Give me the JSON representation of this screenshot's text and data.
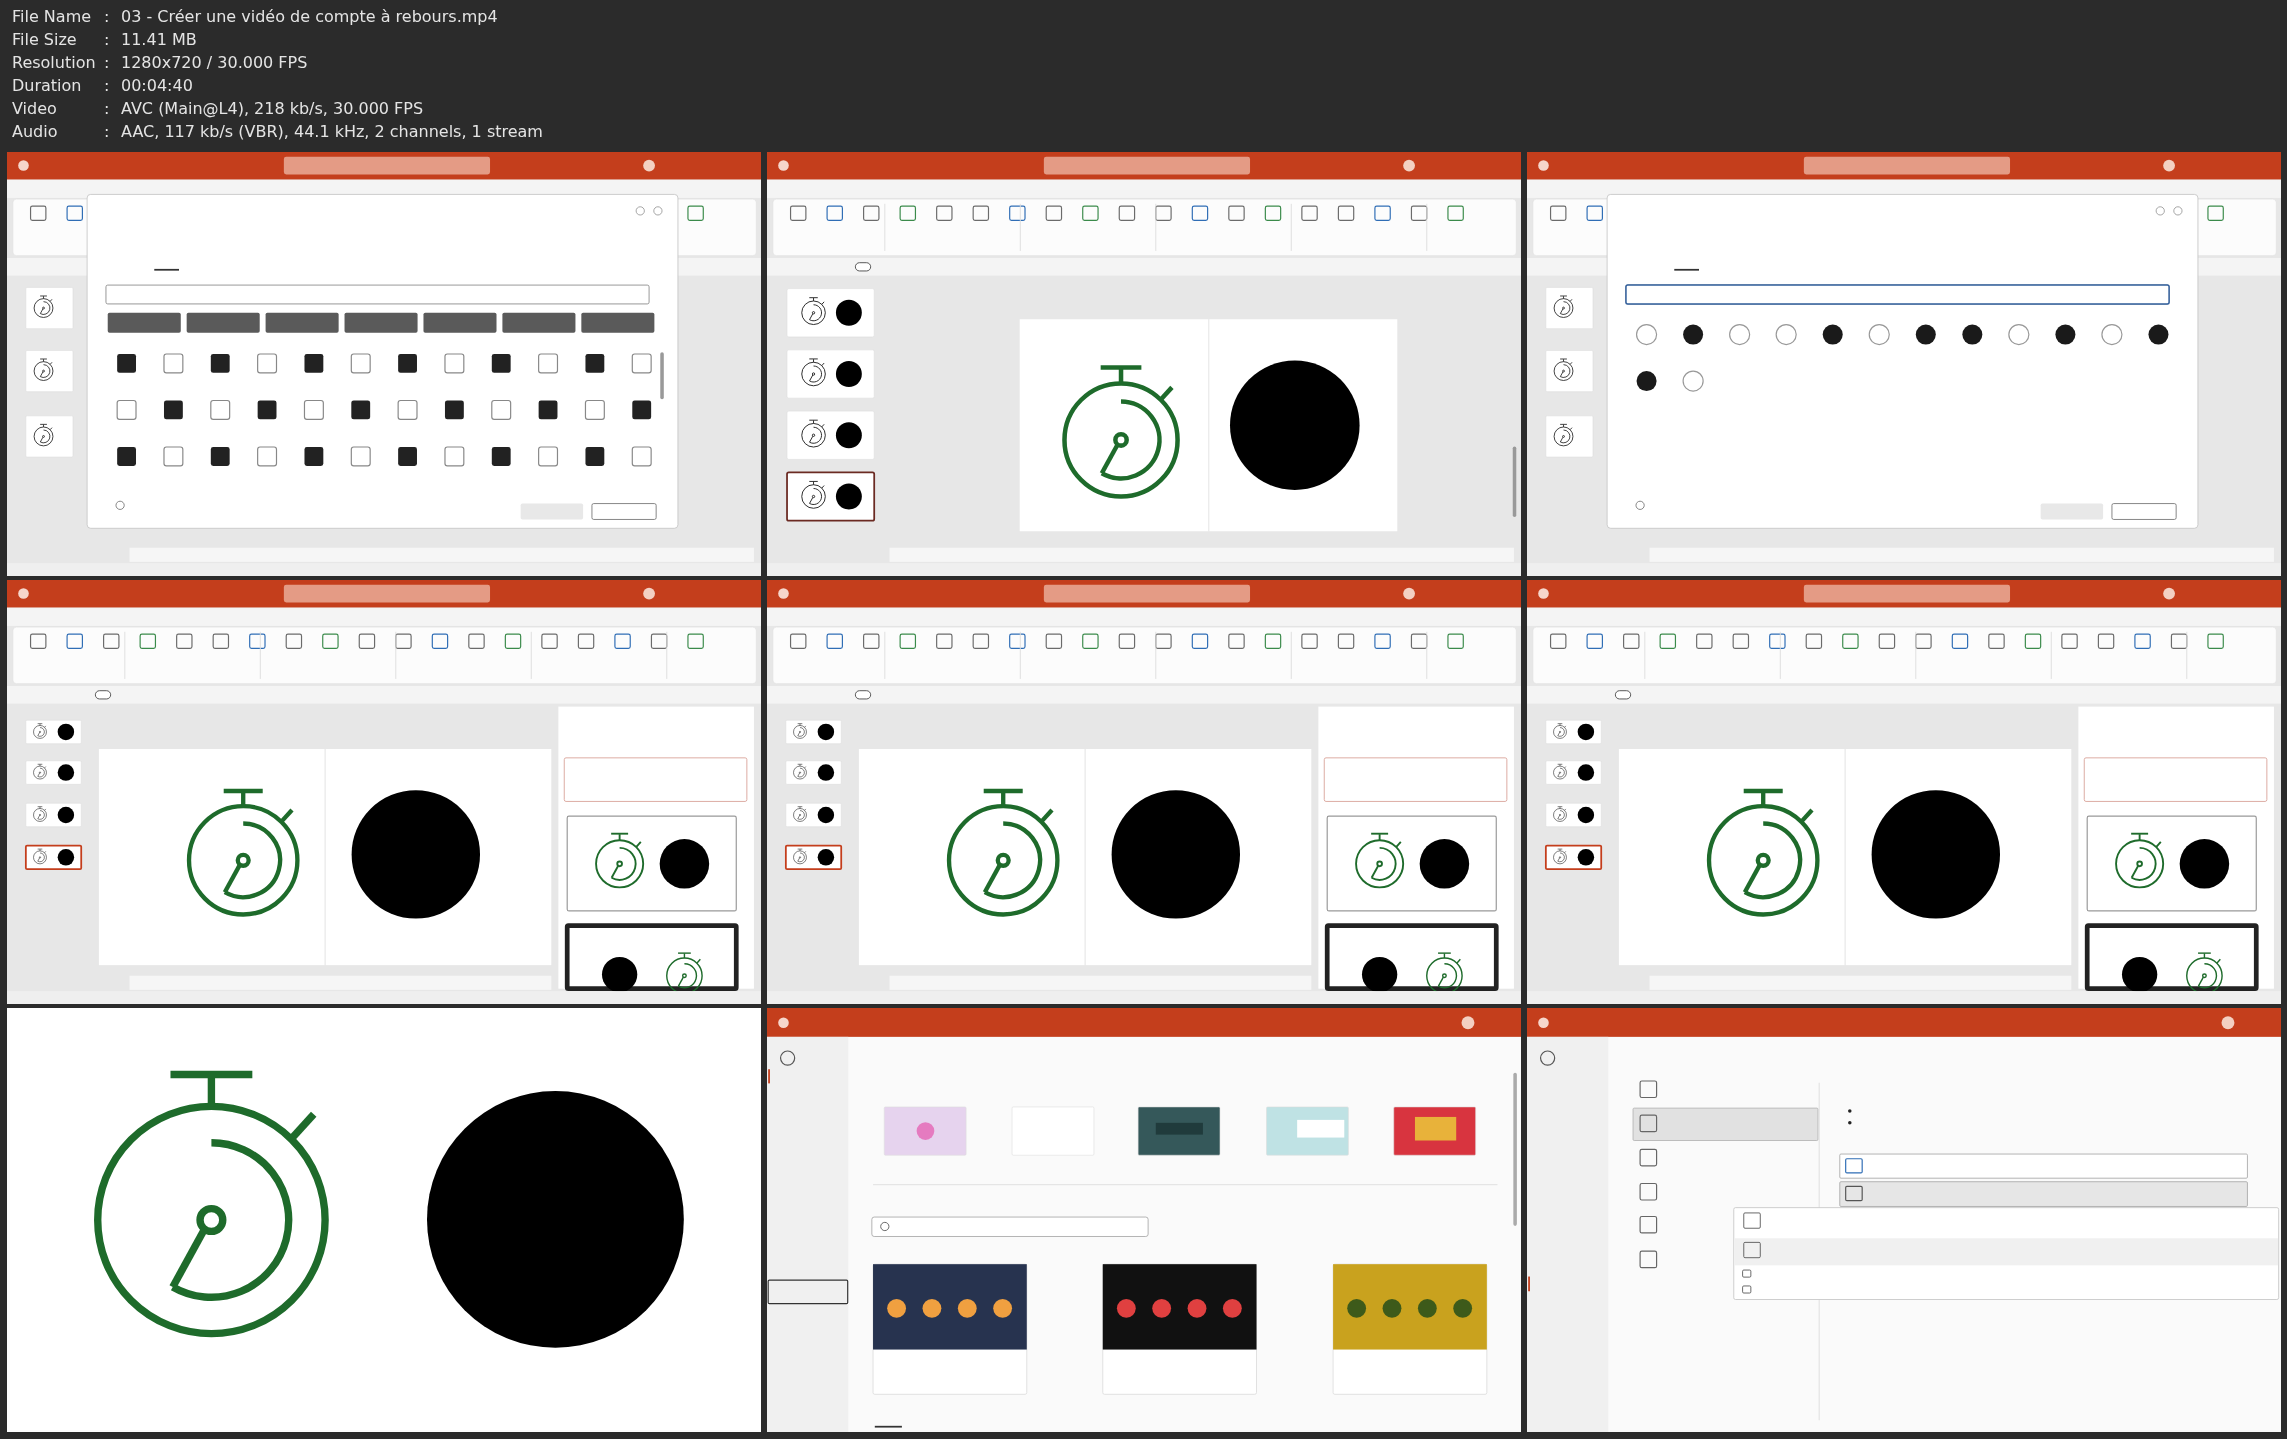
{
  "file_info": [
    {
      "label": "File Name",
      "separator": ":",
      "value": "03 - Créer une vidéo de compte à rebours.mp4"
    },
    {
      "label": "File Size",
      "separator": ":",
      "value": "11.41 MB"
    },
    {
      "label": "Resolution",
      "separator": ":",
      "value": "1280x720 / 30.000 FPS"
    },
    {
      "label": "Duration",
      "separator": ":",
      "value": "00:04:40"
    },
    {
      "label": "Video",
      "separator": ":",
      "value": "AVC (Main@L4), 218 kb/s, 30.000 FPS"
    },
    {
      "label": "Audio",
      "separator": ":",
      "value": "AAC, 117 kb/s (VBR), 44.1 kHz, 2 channels, 1 stream"
    }
  ],
  "frames": [
    {
      "kind": "gallery"
    },
    {
      "kind": "editor"
    },
    {
      "kind": "search"
    },
    {
      "kind": "designer"
    },
    {
      "kind": "designer"
    },
    {
      "kind": "designer"
    },
    {
      "kind": "slideshow"
    },
    {
      "kind": "start"
    },
    {
      "kind": "export"
    }
  ]
}
